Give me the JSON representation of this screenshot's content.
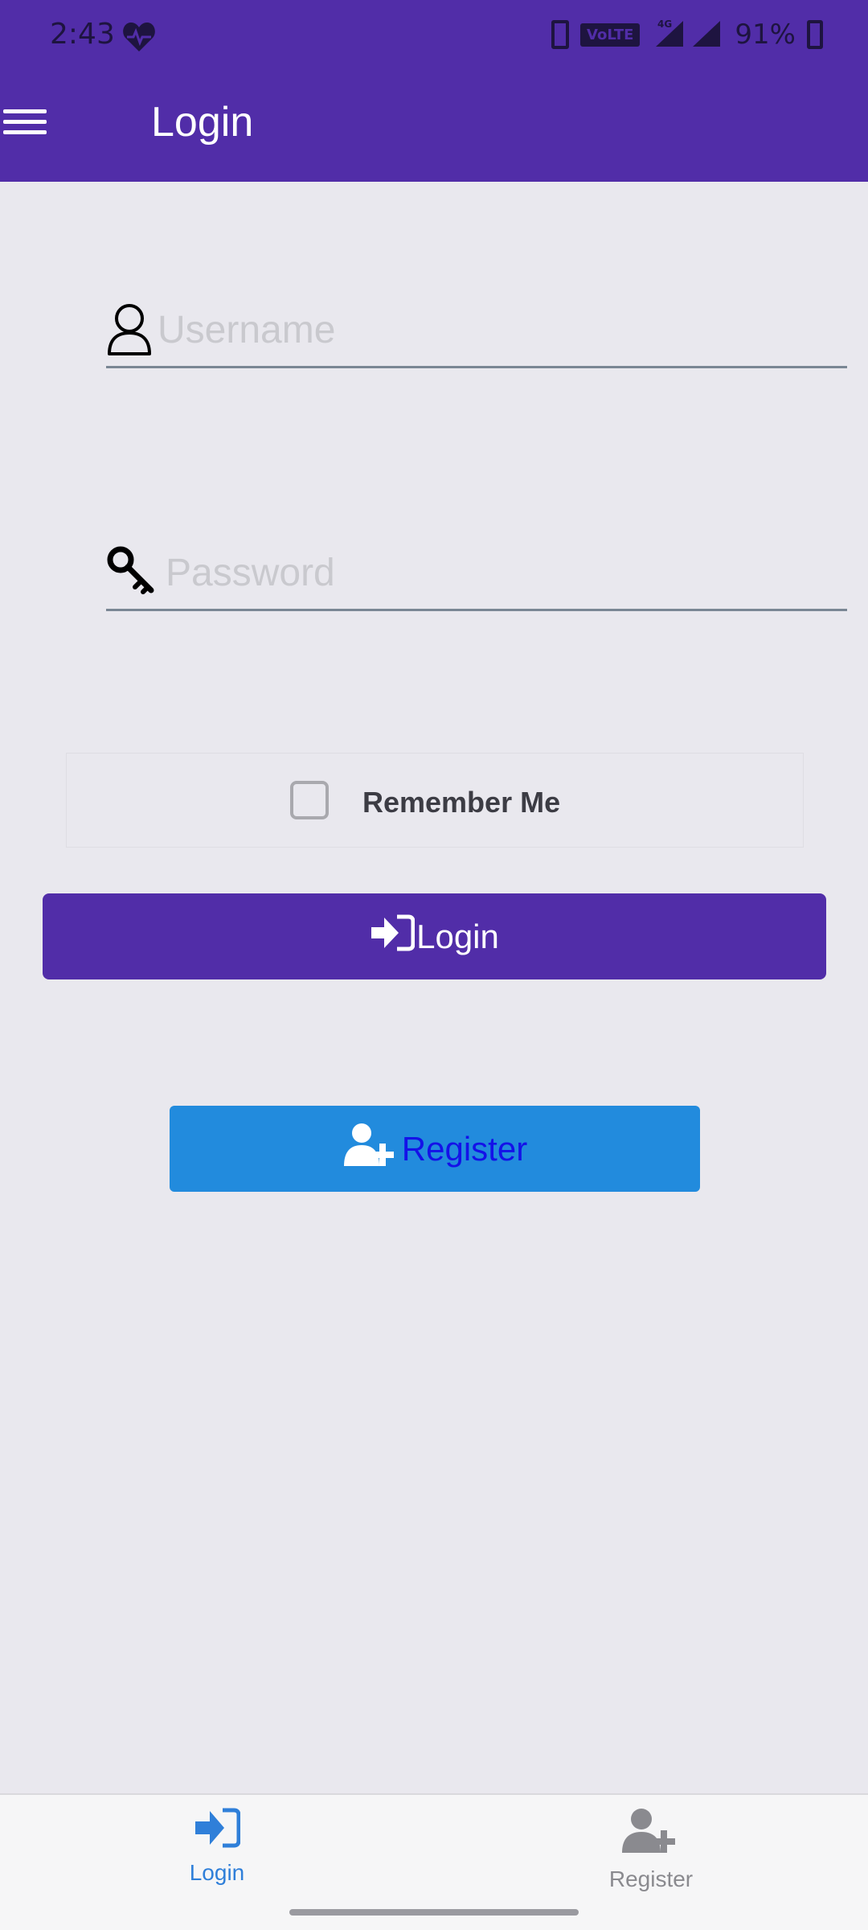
{
  "status_bar": {
    "time": "2:43",
    "volte": "VoLTE",
    "network": "4G",
    "battery": "91%"
  },
  "app_bar": {
    "title": "Login",
    "menu_icon": "hamburger-menu-icon"
  },
  "form": {
    "username_placeholder": "Username",
    "username_value": "",
    "username_icon": "user-icon",
    "password_placeholder": "Password",
    "password_value": "",
    "password_icon": "key-icon",
    "remember_label": "Remember Me",
    "remember_checked": false,
    "login_button_label": "Login",
    "login_button_icon": "sign-in-icon",
    "register_button_label": "Register",
    "register_button_icon": "user-plus-icon"
  },
  "bottom_nav": {
    "items": [
      {
        "label": "Login",
        "icon": "sign-in-icon",
        "active": true
      },
      {
        "label": "Register",
        "icon": "user-plus-icon",
        "active": false
      }
    ]
  },
  "colors": {
    "primary": "#512DA8",
    "register_button": "#228BDD",
    "register_text": "#1411E8",
    "background": "#E9E8EE",
    "nav_active": "#2F7FD9",
    "nav_inactive": "#8A8A8F"
  }
}
